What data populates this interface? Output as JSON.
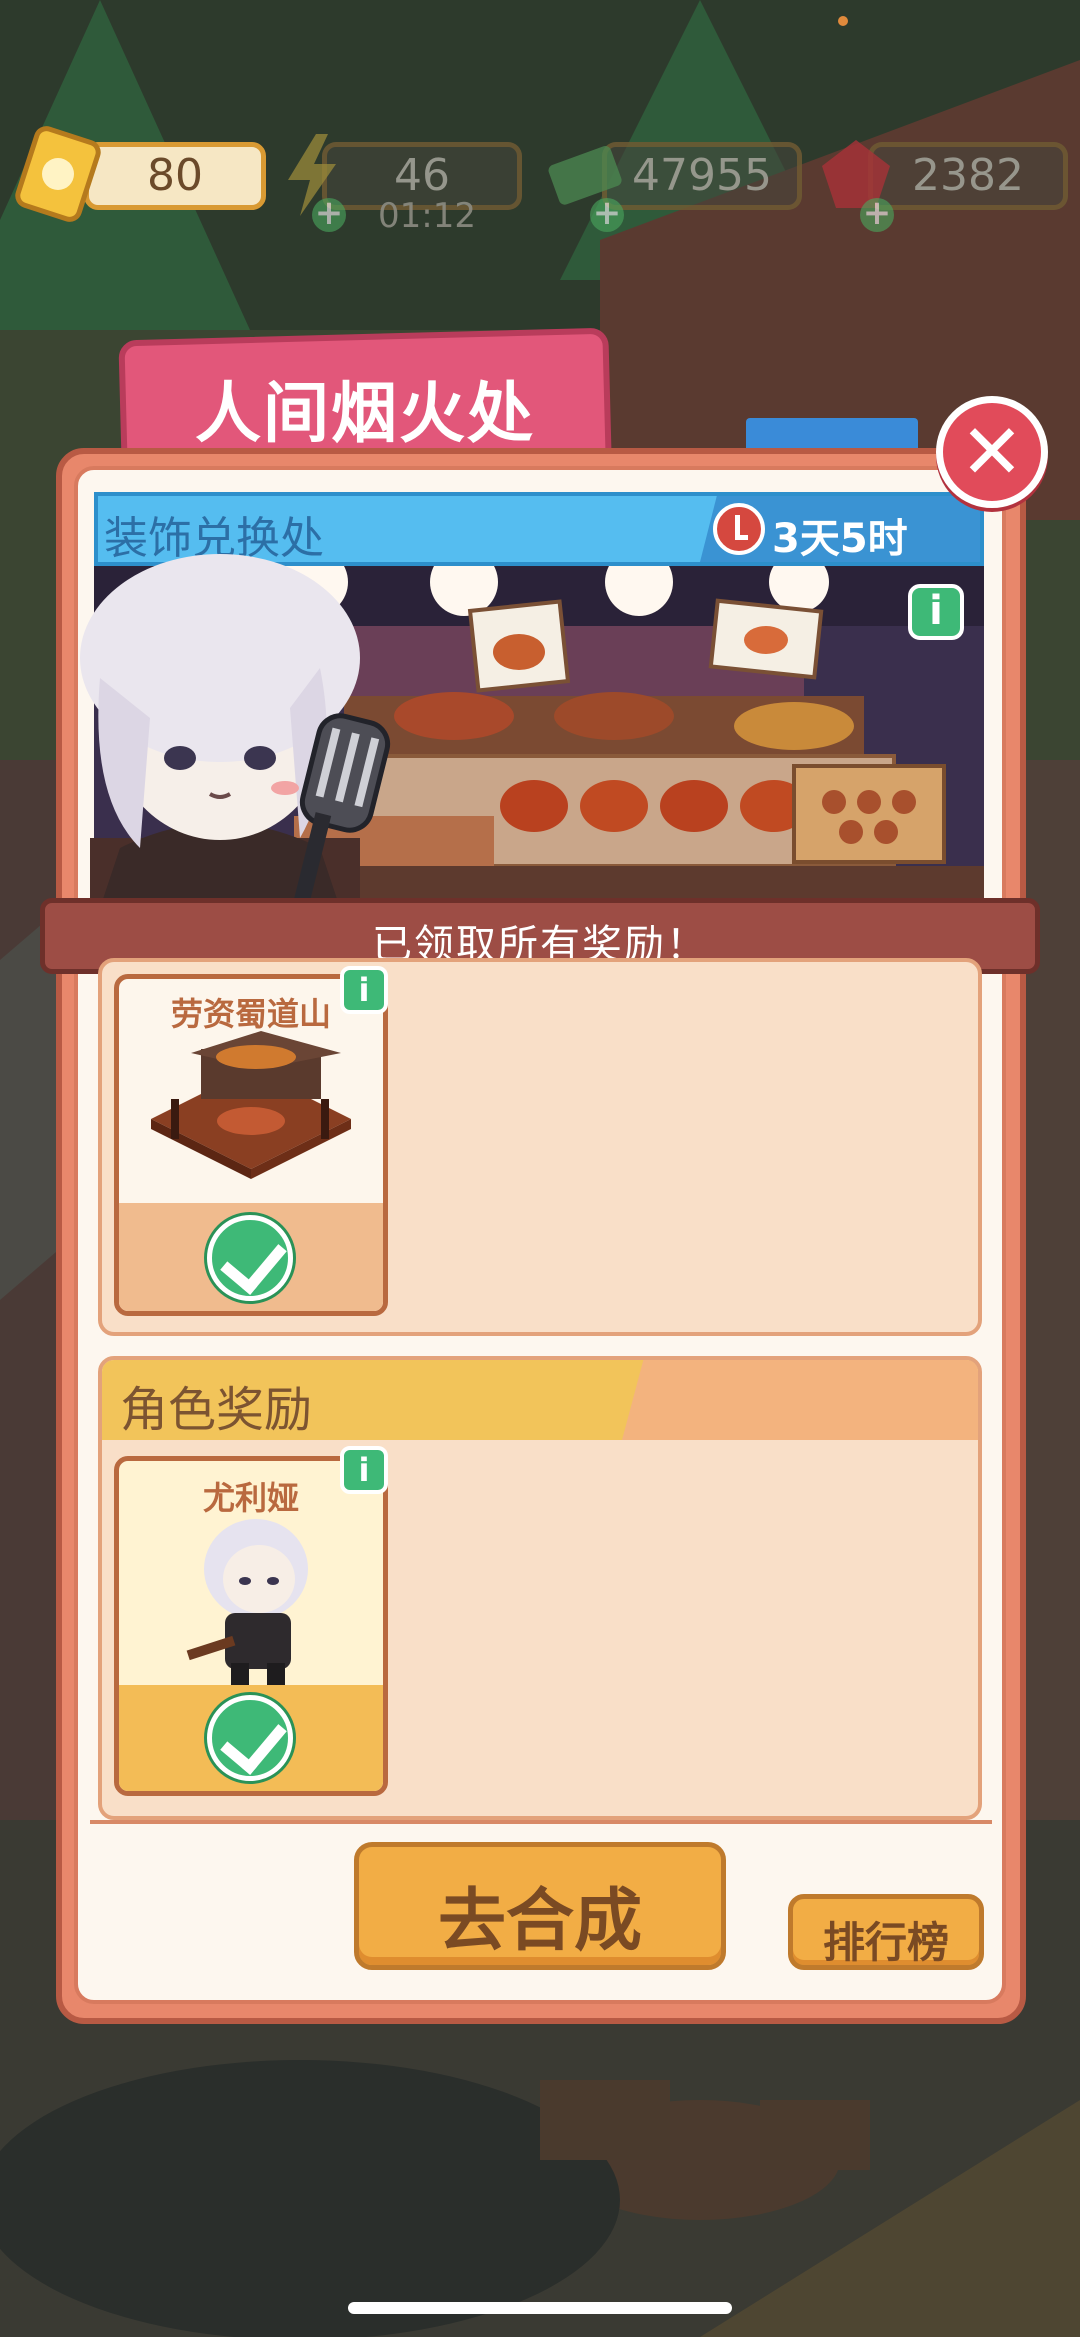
{
  "resources": {
    "tickets": "80",
    "energy": "46",
    "energy_timer": "01:12",
    "cash": "47955",
    "gems": "2382"
  },
  "popup": {
    "title": "人间烟火处",
    "banner_title": "装饰兑换处",
    "banner_timer": "3天5时",
    "status_ribbon": "已领取所有奖励！",
    "section_decor": {
      "item_name": "劳资蜀道山",
      "claimed": true
    },
    "section_character": {
      "title": "角色奖励",
      "item_name": "尤利娅",
      "claimed": true
    },
    "go_button": "去合成",
    "rank_button": "排行榜"
  },
  "icons": {
    "ticket": "ticket-icon",
    "energy": "lightning-icon",
    "cash": "cash-icon",
    "gem": "ruby-icon",
    "close": "close-icon",
    "clock": "clock-icon",
    "info": "info-icon",
    "check": "check-icon"
  },
  "colors": {
    "title_tab": "#e2577a",
    "panel": "#e8876b",
    "banner": "#55bdf0",
    "ribbon": "#9d4d45",
    "button": "#f2ad45",
    "check": "#3eb977"
  }
}
